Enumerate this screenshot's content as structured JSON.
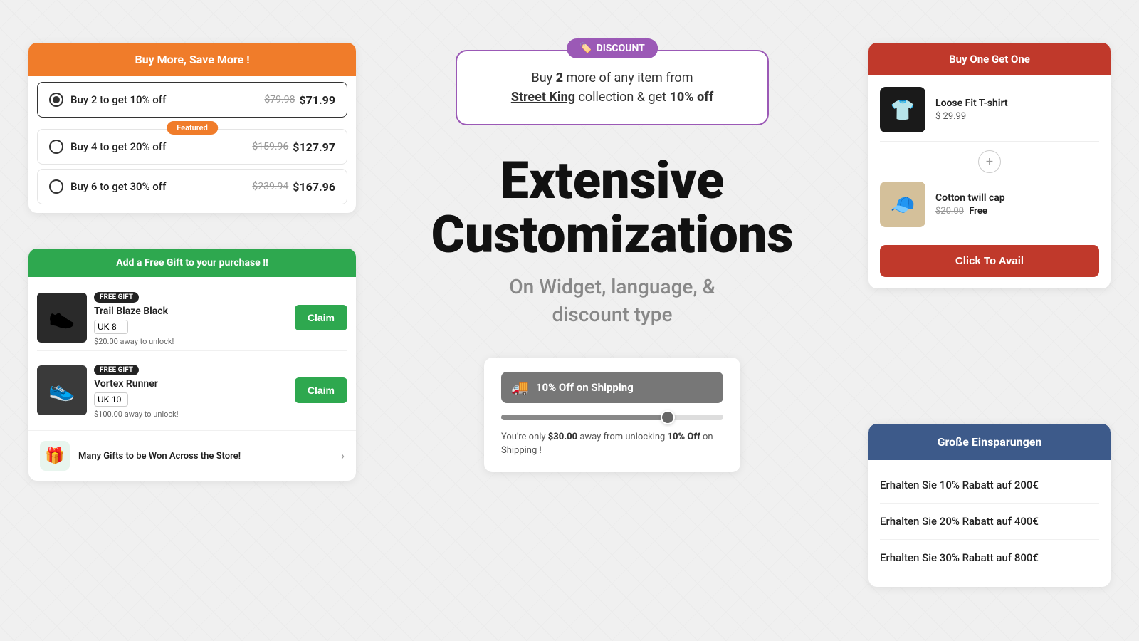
{
  "background": {
    "color": "#f0f0f0"
  },
  "buy_more_widget": {
    "header": "Buy More, Save More !",
    "options": [
      {
        "label": "Buy 2 to get 10% off",
        "original_price": "$79.98",
        "discounted_price": "$71.99",
        "selected": true,
        "featured": false
      },
      {
        "label": "Buy 4 to get 20% off",
        "original_price": "$159.96",
        "discounted_price": "$127.97",
        "selected": false,
        "featured": true,
        "featured_label": "Featured"
      },
      {
        "label": "Buy 6 to get 30% off",
        "original_price": "$239.94",
        "discounted_price": "$167.96",
        "selected": false,
        "featured": false
      }
    ]
  },
  "discount_banner": {
    "label": "DISCOUNT",
    "text_part1": "Buy ",
    "text_bold": "2",
    "text_part2": " more of any item from",
    "brand_underline": "Street King",
    "text_part3": " collection & get ",
    "text_highlight": "10% off"
  },
  "main_headline": {
    "title_line1": "Extensive",
    "title_line2": "Customizations",
    "subtitle_line1": "On Widget, language, &",
    "subtitle_line2": "discount type"
  },
  "shipping_widget": {
    "title": "10% Off on Shipping",
    "progress_percent": 75,
    "description_part1": "You're only ",
    "amount": "$30.00",
    "description_part2": " away from unlocking ",
    "discount": "10% Off",
    "description_part3": " on Shipping !"
  },
  "bogo_widget": {
    "header": "Buy One Get One",
    "item1": {
      "name": "Loose Fit T-shirt",
      "price": "$ 29.99"
    },
    "item2": {
      "name": "Cotton twill cap",
      "original_price": "$20.00",
      "free_label": "Free"
    },
    "cta_label": "Click To Avail"
  },
  "free_gift_widget": {
    "header": "Add a Free Gift to your purchase !!",
    "gifts": [
      {
        "badge": "FREE GIFT",
        "name": "Trail Blaze Black",
        "size_label": "UK 8",
        "unlock_text": "$20.00 away to unlock!",
        "claim_label": "Claim"
      },
      {
        "badge": "FREE GIFT",
        "name": "Vortex Runner",
        "size_label": "UK 10",
        "unlock_text": "$100.00 away to unlock!",
        "claim_label": "Claim"
      }
    ],
    "footer_text": "Many Gifts to be Won Across the Store!"
  },
  "german_widget": {
    "header": "Große Einsparungen",
    "items": [
      "Erhalten Sie 10% Rabatt auf 200€",
      "Erhalten Sie 20% Rabatt auf 400€",
      "Erhalten Sie 30% Rabatt auf 800€"
    ]
  }
}
